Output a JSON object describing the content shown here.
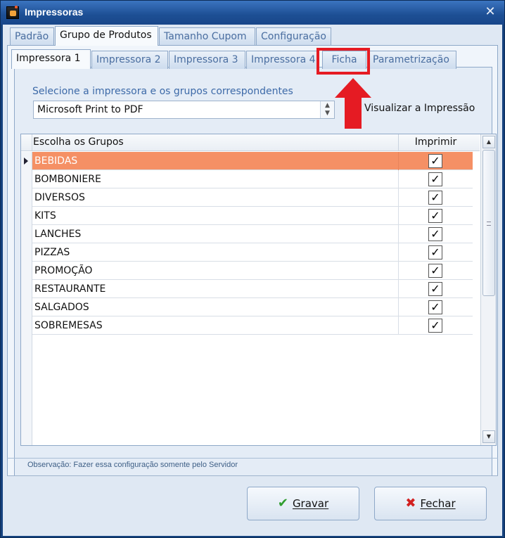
{
  "window": {
    "title": "Impressoras",
    "close_glyph": "✕"
  },
  "top_tabs": [
    "Padrão",
    "Grupo de Produtos",
    "Tamanho Cupom",
    "Configuração"
  ],
  "sub_tabs": [
    "Impressora 1",
    "Impressora 2",
    "Impressora 3",
    "Impressora 4",
    "Ficha",
    "Parametrização"
  ],
  "printer": {
    "label": "Selecione a impressora e os grupos correspondentes",
    "selected": "Microsoft Print to PDF",
    "visualizar_label": "Visualizar a Impressão"
  },
  "grid": {
    "col_groups": "Escolha os Grupos",
    "col_print": "Imprimir",
    "rows": [
      {
        "name": "BEBIDAS",
        "checked": true
      },
      {
        "name": "BOMBONIERE",
        "checked": true
      },
      {
        "name": "DIVERSOS",
        "checked": true
      },
      {
        "name": "KITS",
        "checked": true
      },
      {
        "name": "LANCHES",
        "checked": true
      },
      {
        "name": "PIZZAS",
        "checked": true
      },
      {
        "name": "PROMOÇÃO",
        "checked": true
      },
      {
        "name": "RESTAURANTE",
        "checked": true
      },
      {
        "name": "SALGADOS",
        "checked": true
      },
      {
        "name": "SOBREMESAS",
        "checked": true
      }
    ],
    "check_glyph": "✓"
  },
  "observation": "Observação: Fazer essa configuração somente pelo Servidor",
  "buttons": {
    "save": {
      "label": "Gravar",
      "icon": "✔"
    },
    "close": {
      "label": "Fechar",
      "icon": "✖"
    }
  },
  "colors": {
    "selected_row": "#f59065",
    "highlight": "#e51b23",
    "title_bar": "#1d4f94"
  }
}
